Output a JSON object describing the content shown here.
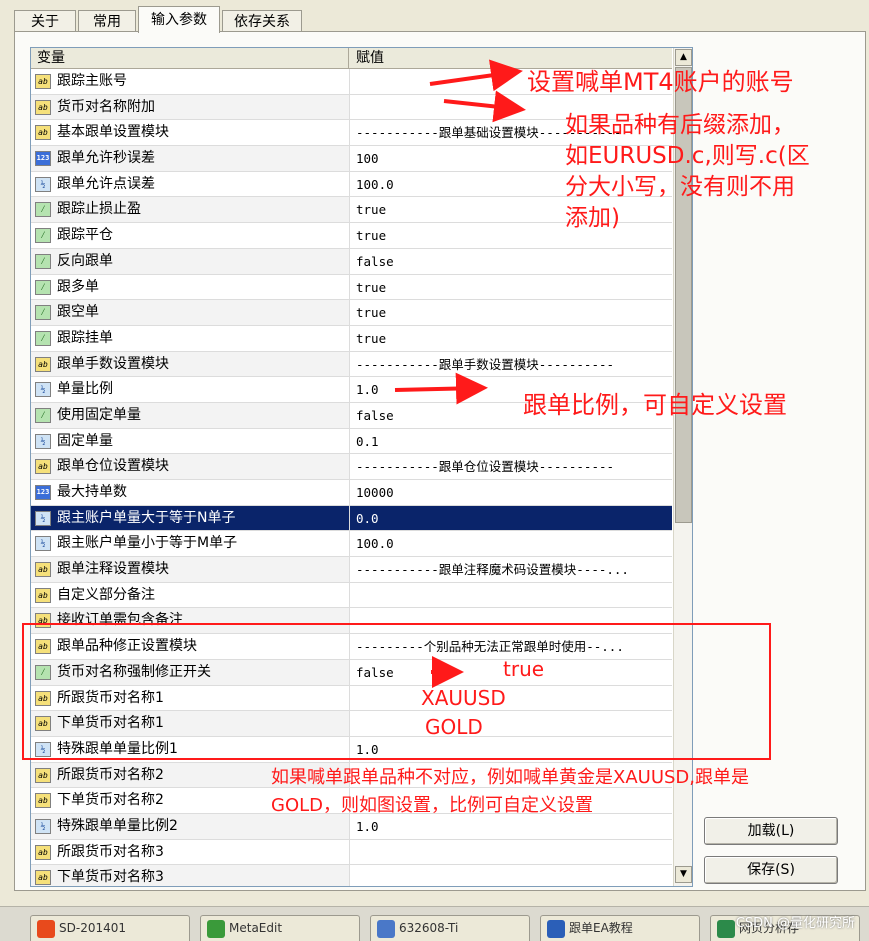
{
  "tabs": [
    "关于",
    "常用",
    "输入参数",
    "依存关系"
  ],
  "active_tab": "输入参数",
  "grid": {
    "col_name": "变量",
    "col_value": "赋值",
    "rows": [
      {
        "type": "ab",
        "name": "跟踪主账号",
        "value": ""
      },
      {
        "type": "ab",
        "name": "货币对名称附加",
        "value": ""
      },
      {
        "type": "ab",
        "name": "基本跟单设置模块",
        "value": "-----------跟单基础设置模块-----------"
      },
      {
        "type": "123",
        "name": "跟单允许秒误差",
        "value": "100"
      },
      {
        "type": "dbl",
        "name": "跟单允许点误差",
        "value": "100.0"
      },
      {
        "type": "bool",
        "name": "跟踪止损止盈",
        "value": "true"
      },
      {
        "type": "bool",
        "name": "跟踪平仓",
        "value": "true"
      },
      {
        "type": "bool",
        "name": "反向跟单",
        "value": "false"
      },
      {
        "type": "bool",
        "name": "跟多单",
        "value": "true"
      },
      {
        "type": "bool",
        "name": "跟空单",
        "value": "true"
      },
      {
        "type": "bool",
        "name": "跟踪挂单",
        "value": "true"
      },
      {
        "type": "ab",
        "name": "跟单手数设置模块",
        "value": "-----------跟单手数设置模块----------"
      },
      {
        "type": "dbl",
        "name": "单量比例",
        "value": "1.0"
      },
      {
        "type": "bool",
        "name": "使用固定单量",
        "value": "false"
      },
      {
        "type": "dbl",
        "name": "固定单量",
        "value": "0.1"
      },
      {
        "type": "ab",
        "name": "跟单仓位设置模块",
        "value": "-----------跟单仓位设置模块----------"
      },
      {
        "type": "123",
        "name": "最大持单数",
        "value": "10000"
      },
      {
        "type": "dbl",
        "name": "跟主账户单量大于等于N单子",
        "value": "0.0",
        "selected": true
      },
      {
        "type": "dbl",
        "name": "跟主账户单量小于等于M单子",
        "value": "100.0"
      },
      {
        "type": "ab",
        "name": "跟单注释设置模块",
        "value": "-----------跟单注释魔术码设置模块----..."
      },
      {
        "type": "ab",
        "name": "自定义部分备注",
        "value": ""
      },
      {
        "type": "ab",
        "name": "接收订单需包含备注",
        "value": ""
      },
      {
        "type": "ab",
        "name": "跟单品种修正设置模块",
        "value": "---------个别品种无法正常跟单时使用--..."
      },
      {
        "type": "bool",
        "name": "货币对名称强制修正开关",
        "value": "false"
      },
      {
        "type": "ab",
        "name": "所跟货币对名称1",
        "value": ""
      },
      {
        "type": "ab",
        "name": "下单货币对名称1",
        "value": ""
      },
      {
        "type": "dbl",
        "name": "特殊跟单单量比例1",
        "value": "1.0"
      },
      {
        "type": "ab",
        "name": "所跟货币对名称2",
        "value": ""
      },
      {
        "type": "ab",
        "name": "下单货币对名称2",
        "value": ""
      },
      {
        "type": "dbl",
        "name": "特殊跟单单量比例2",
        "value": "1.0"
      },
      {
        "type": "ab",
        "name": "所跟货币对名称3",
        "value": ""
      },
      {
        "type": "ab",
        "name": "下单货币对名称3",
        "value": ""
      }
    ]
  },
  "icons": {
    "ab": "ab",
    "123": "123",
    "dbl": "½",
    "bool": "⁄"
  },
  "buttons": {
    "load": "加载(L)",
    "save": "保存(S)"
  },
  "annotations": {
    "a1": "设置喊单MT4账户的账号",
    "a2_line1": "如果品种有后缀添加，",
    "a2_line2": "如EURUSD.c,则写.c(区",
    "a2_line3": "分大小写，没有则不用",
    "a2_line4": "添加)",
    "a3": "跟单比例，可自定义设置",
    "a4_true": "true",
    "a4_xau": "XAUUSD",
    "a4_gold": "GOLD",
    "a5_line1": "如果喊单跟单品种不对应，例如喊单黄金是XAUUSD,跟单是",
    "a5_line2": "GOLD，则如图设置，比例可自定义设置"
  },
  "taskbar": {
    "items": [
      "SD-201401",
      "MetaEdit",
      "632608-Ti",
      "跟单EA教程",
      "网页分析存"
    ],
    "watermark": "CSDN @量化研究所"
  },
  "colors": {
    "annotation": "#ff1a1a",
    "selection": "#0a246a"
  }
}
